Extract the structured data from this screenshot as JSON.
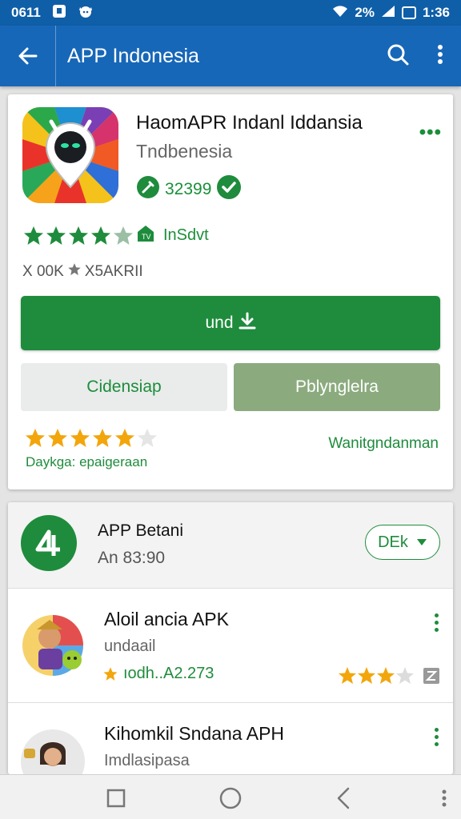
{
  "status_bar": {
    "time_left": "0611",
    "time_right": "1:36",
    "signal_text": "2%"
  },
  "app_bar": {
    "title": "APP Indonesia",
    "back_icon": "arrow-left-icon",
    "search_icon": "search-icon",
    "menu_icon": "more-vert-icon"
  },
  "app_card": {
    "name": "HaomAPR Indanl Iddansia",
    "developer": "Tndbenesia",
    "badge_number": "32399",
    "rating_stars": 4.5,
    "rating_label": "InSdvt",
    "meta": {
      "downloads": "X 00K",
      "size": "X5AKRII"
    },
    "install_label": "und",
    "secondary_left": "Cidensiap",
    "secondary_right": "Pblynglelra",
    "stars2": 5,
    "stars2_caption": "Daykga: epaigeraan",
    "side_link": "Wanitgndanman",
    "colors": {
      "green": "#1e8c3c",
      "blue": "#1767b8",
      "star": "#f2a60c"
    }
  },
  "category": {
    "title": "APP Betani",
    "subtitle": "An 83:90",
    "dropdown_label": "DEk"
  },
  "list": [
    {
      "title": "Aloil ancia APK",
      "subtitle": "undaail",
      "meta": "ıodh..A2.273",
      "stars": 3
    },
    {
      "title": "Kihomkil Sndana APH",
      "subtitle": "Imdlasipasa"
    }
  ],
  "nav_bar": {
    "items": [
      "recent-apps-icon",
      "home-icon",
      "back-icon",
      "more-vert-icon"
    ]
  }
}
